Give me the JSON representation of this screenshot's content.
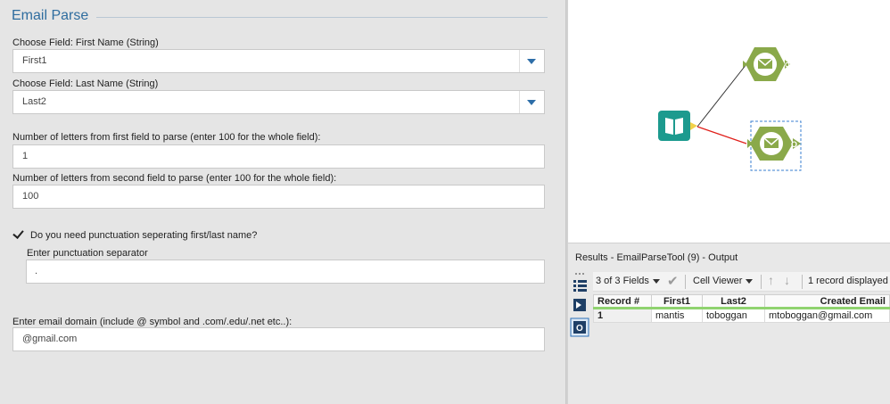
{
  "config": {
    "title": "Email Parse",
    "first_field_label": "Choose Field: First Name (String)",
    "first_field_value": "First1",
    "last_field_label": "Choose Field: Last Name (String)",
    "last_field_value": "Last2",
    "first_letters_label": "Number of letters from first field to parse (enter 100 for the whole field):",
    "first_letters_value": "1",
    "second_letters_label": "Number of letters from second field to parse (enter 100 for the whole field):",
    "second_letters_value": "100",
    "punctuation_checkbox_label": "Do you need punctuation seperating first/last name?",
    "punctuation_checked": true,
    "separator_label": "Enter punctuation separator",
    "separator_value": ".",
    "domain_label": "Enter email domain (include @ symbol and .com/.edu/.net etc..):",
    "domain_value": "@gmail.com"
  },
  "canvas": {
    "tools": [
      {
        "name": "input-data-tool",
        "color": "#1c9a8e"
      },
      {
        "name": "email-parse-tool-1",
        "color": "#8aa94a"
      },
      {
        "name": "email-parse-tool-2",
        "color": "#8aa94a",
        "selected": true
      }
    ],
    "connection_colors": {
      "normal": "#333333",
      "selected": "#e0201b"
    }
  },
  "results": {
    "title": "Results - EmailParseTool (9) - Output",
    "fields_selector": "3 of 3 Fields",
    "cell_viewer": "Cell Viewer",
    "record_count": "1 record displayed",
    "columns": [
      "Record #",
      "First1",
      "Last2",
      "Created Email"
    ],
    "rows": [
      [
        "1",
        "mantis",
        "toboggan",
        "mtoboggan@gmail.com"
      ]
    ]
  }
}
